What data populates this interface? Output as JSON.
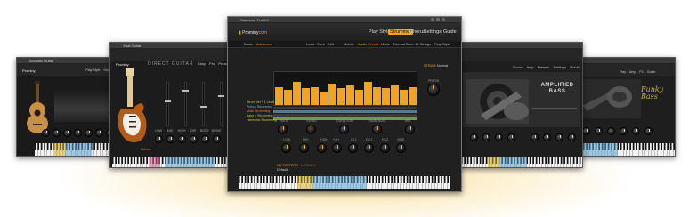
{
  "main": {
    "title": "Strummer Pro 2.0",
    "brand_name": "Prominy",
    "brand_dot": "com",
    "nav": [
      "Play Style",
      "Strummer",
      "Chorus",
      "Settings",
      "Guide"
    ],
    "nav_active_index": 1,
    "toolbar": [
      "Basic",
      "Advanced",
      "Load",
      "Save",
      "Edit",
      "Mobile",
      "Audio Preset",
      "Mode",
      "Normal Bars",
      "16 Strings",
      "Play Style"
    ],
    "toolbar_active": "Advanced",
    "strum_label": "STRUM",
    "pattern_name": "Normal",
    "seq_rows": [
      "Strum Vel + 1 Level",
      "Pickup Strumming",
      "Mute Strumming",
      "Bass + Strumming",
      "Harmonic Strumming"
    ],
    "velocities": [
      0.55,
      0.45,
      0.7,
      0.5,
      0.55,
      0.4,
      0.65,
      0.5,
      0.6,
      0.45,
      0.7,
      0.55,
      0.5,
      0.6,
      0.45,
      0.55
    ],
    "knob_row1": [
      "RATE",
      "SWING",
      "DURATION",
      "HUMANIZE",
      "MIX"
    ],
    "knob_row2": [
      "LOW",
      "MID",
      "HIGH",
      "CH1",
      "CL1",
      "DC1",
      "DC2",
      "VIBE"
    ],
    "right_knob_label": "PRESS",
    "footer_title": "MY PATTERN",
    "footer_sub": "Default",
    "footer_status": "LATENCY"
  },
  "left_far": {
    "title": "Acoustic Guitar",
    "brand_name": "Prominy",
    "nav": [
      "Play Style",
      "Guide"
    ],
    "knobs": [
      "LOW",
      "MID",
      "HIGH",
      "CH",
      "CL",
      "DL",
      "VIBE",
      "MIX"
    ]
  },
  "left_mid": {
    "title": "Strat Guitar",
    "brand_name": "Prominy",
    "section_title": "DIRECT GUITAR",
    "nav": [
      "Easy",
      "Pro",
      "Presets"
    ],
    "knobs": [
      "LOW",
      "MID",
      "HIGH",
      "DIR",
      "BODY",
      "DRIVE"
    ],
    "status": "Stereo"
  },
  "right_mid": {
    "nav": [
      "Sound",
      "Amp",
      "Presets",
      "Settings",
      "Guide"
    ],
    "logo_text": "AMPLIFIED BASS",
    "knobs": [
      "LOW",
      "MID",
      "HIGH",
      "DRIVE",
      "TONE",
      "VOL"
    ]
  },
  "right_far": {
    "nav": [
      "Play",
      "Amp",
      "FX",
      "Guide"
    ],
    "logo_text": "Funky Bass",
    "knobs": [
      "LOW",
      "MID",
      "HIGH",
      "TONE",
      "VOL"
    ]
  },
  "colors": {
    "accent": "#f2a324",
    "seq_row_colors": [
      "#b9c94a",
      "#6fb0d8",
      "#e07a4a",
      "#9ad06a",
      "#d6c24a"
    ]
  }
}
